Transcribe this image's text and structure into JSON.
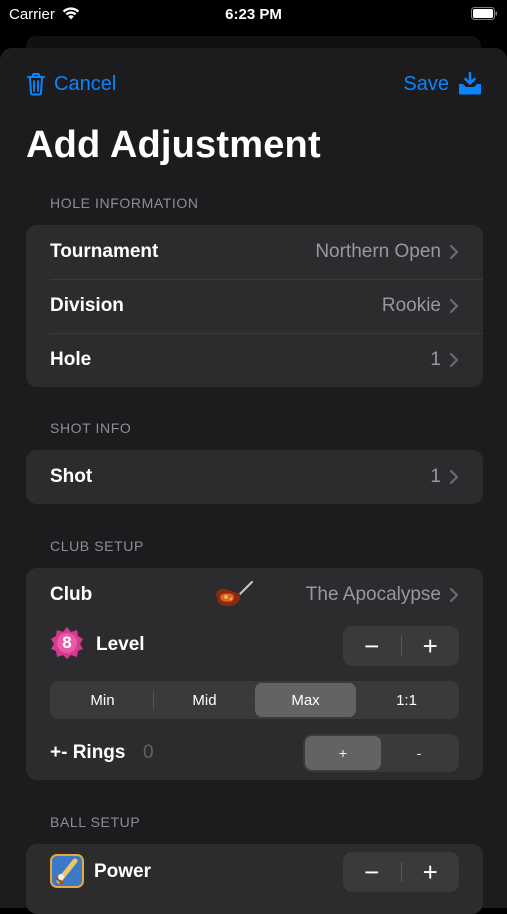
{
  "status_bar": {
    "carrier": "Carrier",
    "time": "6:23 PM"
  },
  "nav": {
    "cancel_label": "Cancel",
    "save_label": "Save",
    "accent_color": "#0a84ff"
  },
  "title": "Add Adjustment",
  "sections": {
    "hole_info": {
      "header": "HOLE INFORMATION",
      "rows": [
        {
          "label": "Tournament",
          "value": "Northern Open"
        },
        {
          "label": "Division",
          "value": "Rookie"
        },
        {
          "label": "Hole",
          "value": "1"
        }
      ]
    },
    "shot_info": {
      "header": "SHOT INFO",
      "rows": [
        {
          "label": "Shot",
          "value": "1"
        }
      ]
    },
    "club_setup": {
      "header": "CLUB SETUP",
      "club": {
        "label": "Club",
        "value": "The Apocalypse",
        "icon": "golf-club-icon"
      },
      "level": {
        "label": "Level",
        "badge": "8",
        "minus": "−",
        "plus": "+"
      },
      "level_mode": {
        "options": [
          "Min",
          "Mid",
          "Max",
          "1:1"
        ],
        "selected": "Max"
      },
      "rings": {
        "label": "+- Rings",
        "count": "0",
        "options": [
          "+",
          "-"
        ],
        "selected": "+"
      }
    },
    "ball_setup": {
      "header": "BALL SETUP",
      "power": {
        "label": "Power",
        "icon": "power-ball-icon",
        "minus": "−",
        "plus": "+"
      }
    }
  }
}
